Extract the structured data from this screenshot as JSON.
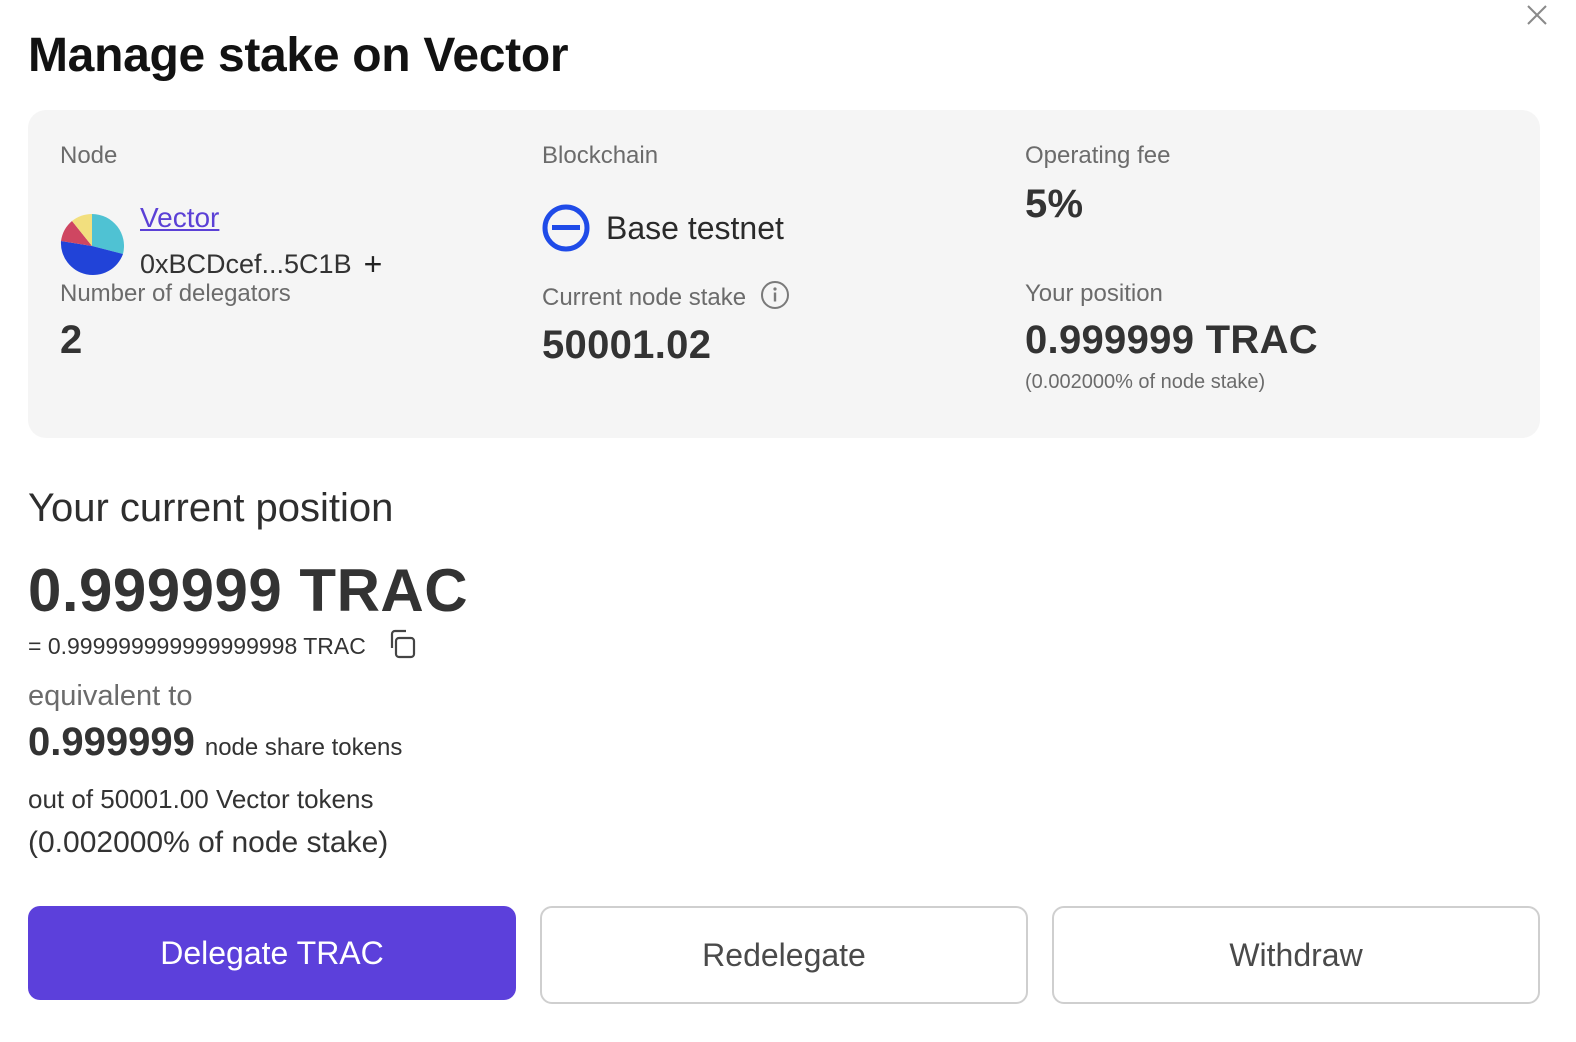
{
  "modal": {
    "title": "Manage stake on Vector",
    "close_icon": "close-icon"
  },
  "node_info": {
    "node_label": "Node",
    "node_name": "Vector",
    "node_address": "0xBCDcef...5C1B",
    "add_icon": "plus-icon",
    "blockchain_label": "Blockchain",
    "blockchain_name": "Base testnet",
    "blockchain_icon": "base-network-icon",
    "operating_fee_label": "Operating fee",
    "operating_fee_value": "5%",
    "delegators_label": "Number of delegators",
    "delegators_value": "2",
    "current_stake_label": "Current node stake",
    "current_stake_value": "50001.02",
    "info_icon": "info-icon",
    "your_position_label": "Your position",
    "your_position_value": "0.999999 TRAC",
    "your_position_pct": "(0.002000% of node stake)"
  },
  "current_position": {
    "title": "Your current position",
    "value": "0.999999 TRAC",
    "exact_value": "= 0.999999999999999998 TRAC",
    "copy_icon": "copy-icon",
    "equivalent_label": "equivalent to",
    "shares_value": "0.999999",
    "shares_unit": "node share tokens",
    "out_of": "out of 50001.00 Vector tokens",
    "pct_of_stake": "(0.002000% of node stake)"
  },
  "actions": {
    "delegate_label": "Delegate TRAC",
    "redelegate_label": "Redelegate",
    "withdraw_label": "Withdraw"
  },
  "colors": {
    "accent": "#5c40db",
    "card_bg": "#f5f5f5",
    "base_blue": "#1f4be8"
  }
}
